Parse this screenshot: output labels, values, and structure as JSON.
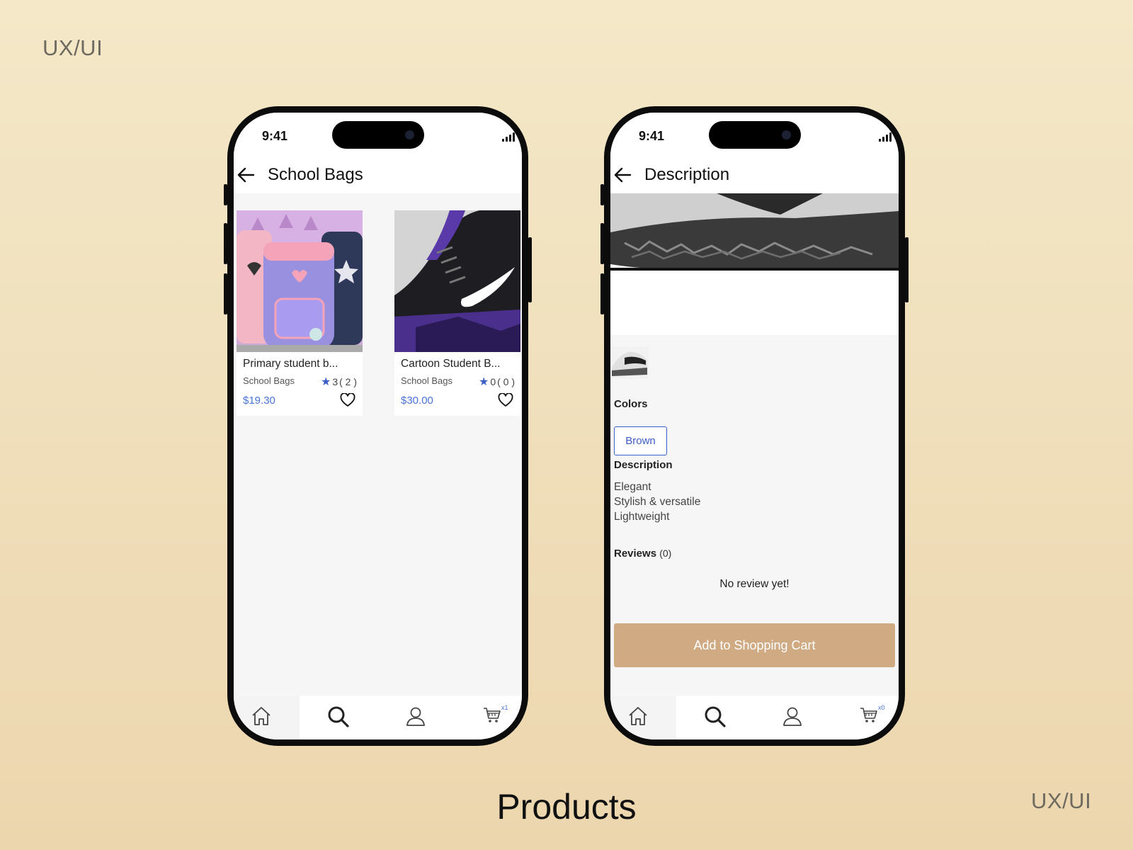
{
  "labels": {
    "top_left": "UX/UI",
    "bottom_right": "UX/UI",
    "page_title": "Products"
  },
  "status": {
    "time": "9:41"
  },
  "list_screen": {
    "title": "School Bags",
    "products": [
      {
        "name": "Primary student b...",
        "category": "School Bags",
        "rating": "3",
        "review_count": "( 2 )",
        "price": "$19.30"
      },
      {
        "name": "Cartoon Student B...",
        "category": "School Bags",
        "rating": "0",
        "review_count": "( 0 )",
        "price": "$30.00"
      }
    ],
    "cart_badge": "x1"
  },
  "detail_screen": {
    "title": "Description",
    "colors_label": "Colors",
    "color_selected": "Brown",
    "description_label": "Description",
    "description_lines": [
      "Elegant",
      "Stylish & versatile",
      "Lightweight"
    ],
    "reviews_label": "Reviews",
    "reviews_count": "(0)",
    "no_review_text": "No review yet!",
    "add_to_cart_label": "Add to Shopping Cart",
    "cart_badge": "x0"
  },
  "colors": {
    "accent_blue": "#3c5fc7",
    "price_blue": "#4a72d9",
    "cart_button": "#cfaa83"
  }
}
